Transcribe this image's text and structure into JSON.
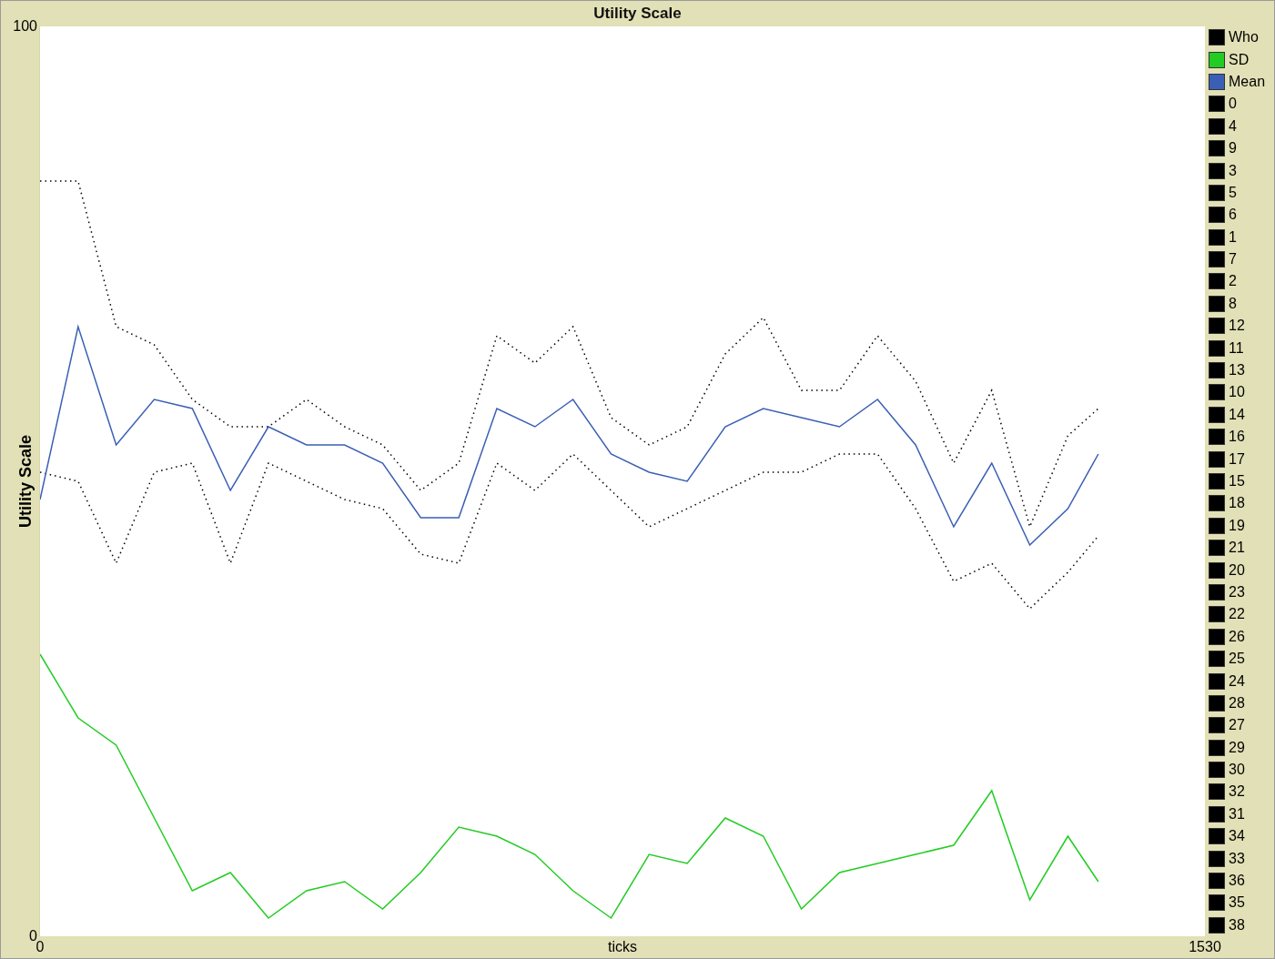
{
  "window": {
    "title": "Utility Scale"
  },
  "chart": {
    "chart_data": {
      "type": "line",
      "xlabel": "ticks",
      "ylabel": "Utility Scale",
      "xlim": [
        0,
        1530
      ],
      "ylim": [
        0,
        100
      ],
      "xticks": [
        0,
        1530
      ],
      "yticks": [
        0,
        100
      ],
      "legend": "right",
      "x": [
        0,
        50,
        100,
        150,
        200,
        250,
        300,
        350,
        400,
        450,
        500,
        550,
        600,
        650,
        700,
        750,
        800,
        850,
        900,
        950,
        1000,
        1050,
        1100,
        1150,
        1200,
        1250,
        1300,
        1350,
        1390
      ],
      "series": [
        {
          "name": "Who",
          "line_style": "dotted",
          "color": "#000000",
          "values": [
            83,
            83,
            67,
            65,
            59,
            56,
            56,
            59,
            56,
            54,
            49,
            52,
            66,
            63,
            67,
            57,
            54,
            56,
            64,
            68,
            60,
            60,
            66,
            61,
            52,
            60,
            45,
            55,
            58
          ]
        },
        {
          "line_style": "dotted",
          "color": "#000000",
          "values": [
            51,
            50,
            41,
            51,
            52,
            41,
            52,
            50,
            48,
            47,
            42,
            41,
            52,
            49,
            53,
            49,
            45,
            47,
            49,
            51,
            51,
            53,
            53,
            47,
            39,
            41,
            36,
            40,
            44
          ]
        },
        {
          "name": "SD",
          "line_style": "solid",
          "color": "#22cc22",
          "values": [
            31,
            24,
            21,
            13,
            5,
            7,
            2,
            5,
            6,
            3,
            7,
            12,
            11,
            9,
            5,
            2,
            9,
            8,
            13,
            11,
            3,
            7,
            8,
            9,
            10,
            16,
            4,
            11,
            6
          ]
        },
        {
          "name": "Mean",
          "line_style": "solid",
          "color": "#3a5fb5",
          "values": [
            48,
            67,
            54,
            59,
            58,
            49,
            56,
            54,
            54,
            52,
            46,
            46,
            58,
            56,
            59,
            53,
            51,
            50,
            56,
            58,
            57,
            56,
            59,
            54,
            45,
            52,
            43,
            47,
            53
          ]
        }
      ]
    }
  },
  "legend": [
    {
      "name": "0",
      "color": "#000000"
    },
    {
      "name": "4",
      "color": "#000000"
    },
    {
      "name": "9",
      "color": "#000000"
    },
    {
      "name": "3",
      "color": "#000000"
    },
    {
      "name": "5",
      "color": "#000000"
    },
    {
      "name": "6",
      "color": "#000000"
    },
    {
      "name": "1",
      "color": "#000000"
    },
    {
      "name": "7",
      "color": "#000000"
    },
    {
      "name": "2",
      "color": "#000000"
    },
    {
      "name": "8",
      "color": "#000000"
    },
    {
      "name": "12",
      "color": "#000000"
    },
    {
      "name": "11",
      "color": "#000000"
    },
    {
      "name": "13",
      "color": "#000000"
    },
    {
      "name": "10",
      "color": "#000000"
    },
    {
      "name": "14",
      "color": "#000000"
    },
    {
      "name": "16",
      "color": "#000000"
    },
    {
      "name": "17",
      "color": "#000000"
    },
    {
      "name": "15",
      "color": "#000000"
    },
    {
      "name": "18",
      "color": "#000000"
    },
    {
      "name": "19",
      "color": "#000000"
    },
    {
      "name": "21",
      "color": "#000000"
    },
    {
      "name": "20",
      "color": "#000000"
    },
    {
      "name": "23",
      "color": "#000000"
    },
    {
      "name": "22",
      "color": "#000000"
    },
    {
      "name": "26",
      "color": "#000000"
    },
    {
      "name": "25",
      "color": "#000000"
    },
    {
      "name": "24",
      "color": "#000000"
    },
    {
      "name": "28",
      "color": "#000000"
    },
    {
      "name": "27",
      "color": "#000000"
    },
    {
      "name": "29",
      "color": "#000000"
    },
    {
      "name": "30",
      "color": "#000000"
    },
    {
      "name": "32",
      "color": "#000000"
    },
    {
      "name": "31",
      "color": "#000000"
    },
    {
      "name": "34",
      "color": "#000000"
    },
    {
      "name": "33",
      "color": "#000000"
    },
    {
      "name": "36",
      "color": "#000000"
    },
    {
      "name": "35",
      "color": "#000000"
    },
    {
      "name": "38",
      "color": "#000000"
    }
  ]
}
